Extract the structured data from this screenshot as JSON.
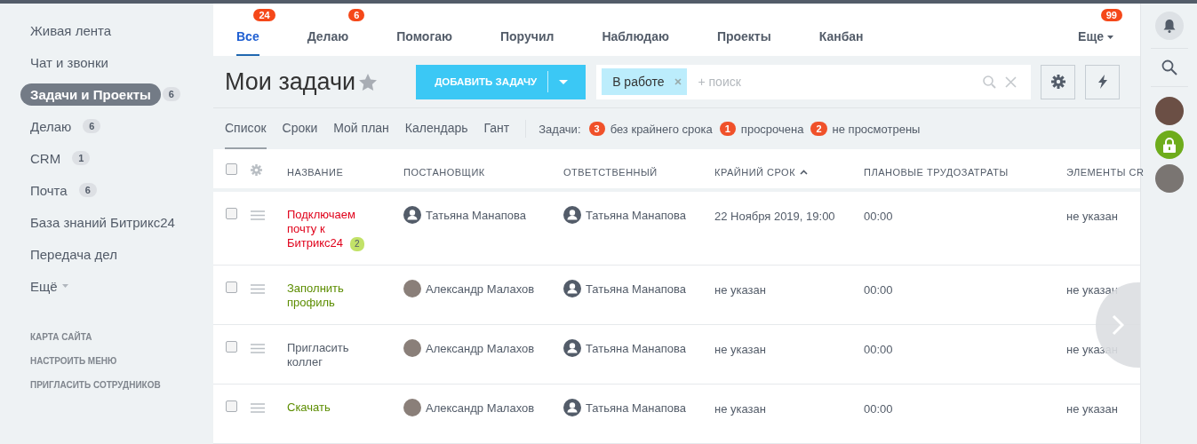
{
  "sidebar": {
    "items": [
      {
        "label": "Живая лента",
        "selected": false
      },
      {
        "label": "Чат и звонки",
        "selected": false
      },
      {
        "label": "Задачи и Проекты",
        "selected": true,
        "count": "6"
      },
      {
        "label": "Делаю",
        "selected": false,
        "count": "6"
      },
      {
        "label": "CRM",
        "selected": false,
        "count": "1"
      },
      {
        "label": "Почта",
        "selected": false,
        "count": "6"
      },
      {
        "label": "База знаний Битрикс24",
        "selected": false
      },
      {
        "label": "Передача дел",
        "selected": false
      },
      {
        "label": "Ещё",
        "selected": false,
        "dropdown": true
      }
    ],
    "links": [
      "КАРТА САЙТА",
      "НАСТРОИТЬ МЕНЮ",
      "ПРИГЛАСИТЬ СОТРУДНИКОВ"
    ]
  },
  "tabs": [
    {
      "label": "Все",
      "selected": true,
      "count": "24"
    },
    {
      "label": "Делаю",
      "selected": false,
      "count": "6"
    },
    {
      "label": "Помогаю",
      "selected": false
    },
    {
      "label": "Поручил",
      "selected": false
    },
    {
      "label": "Наблюдаю",
      "selected": false
    },
    {
      "label": "Проекты",
      "selected": false
    },
    {
      "label": "Канбан",
      "selected": false
    }
  ],
  "more_tab": {
    "label": "Еще",
    "count": "99"
  },
  "title": "Мои задачи",
  "add_button": "ДОБАВИТЬ ЗАДАЧУ",
  "filter": {
    "chip": "В работе",
    "placeholder": "+ поиск"
  },
  "views": [
    {
      "label": "Список",
      "selected": true
    },
    {
      "label": "Сроки",
      "selected": false
    },
    {
      "label": "Мой план",
      "selected": false
    },
    {
      "label": "Календарь",
      "selected": false
    },
    {
      "label": "Гант",
      "selected": false
    }
  ],
  "counters": {
    "label": "Задачи:",
    "items": [
      {
        "count": "3",
        "text": "без крайнего срока"
      },
      {
        "count": "1",
        "text": "просрочена"
      },
      {
        "count": "2",
        "text": "не просмотрены"
      }
    ]
  },
  "table": {
    "all_checked": false,
    "columns": [
      "НАЗВАНИЕ",
      "ПОСТАНОВЩИК",
      "ОТВЕТСТВЕННЫЙ",
      "КРАЙНИЙ СРОК",
      "ПЛАНОВЫЕ ТРУДОЗАТРАТЫ",
      "ЭЛЕМЕНТЫ CR"
    ],
    "rows": [
      {
        "title": "Подключаем почту к Битрикс24",
        "color": "#e0001a",
        "comments": "2",
        "creator": {
          "name": "Татьяна Манапова",
          "kind": "silhouette"
        },
        "responsible": {
          "name": "Татьяна Манапова",
          "kind": "silhouette"
        },
        "deadline": "22 Ноября 2019, 19:00",
        "effort": "00:00",
        "crm": "не указан",
        "checked": false
      },
      {
        "title": "Заполнить профиль",
        "color": "#5c8d00",
        "creator": {
          "name": "Александр Малахов",
          "kind": "photo"
        },
        "responsible": {
          "name": "Татьяна Манапова",
          "kind": "silhouette"
        },
        "deadline": "не указан",
        "effort": "00:00",
        "crm": "не указан",
        "checked": false
      },
      {
        "title": "Пригласить коллег",
        "color": "#535c69",
        "creator": {
          "name": "Александр Малахов",
          "kind": "photo"
        },
        "responsible": {
          "name": "Татьяна Манапова",
          "kind": "silhouette"
        },
        "deadline": "не указан",
        "effort": "00:00",
        "crm": "не указан",
        "checked": false
      },
      {
        "title": "Скачать",
        "color": "#5c8d00",
        "creator": {
          "name": "Александр Малахов",
          "kind": "photo"
        },
        "responsible": {
          "name": "Татьяна Манапова",
          "kind": "silhouette"
        },
        "deadline": "не указан",
        "effort": "00:00",
        "crm": "не указан",
        "checked": false
      }
    ]
  }
}
